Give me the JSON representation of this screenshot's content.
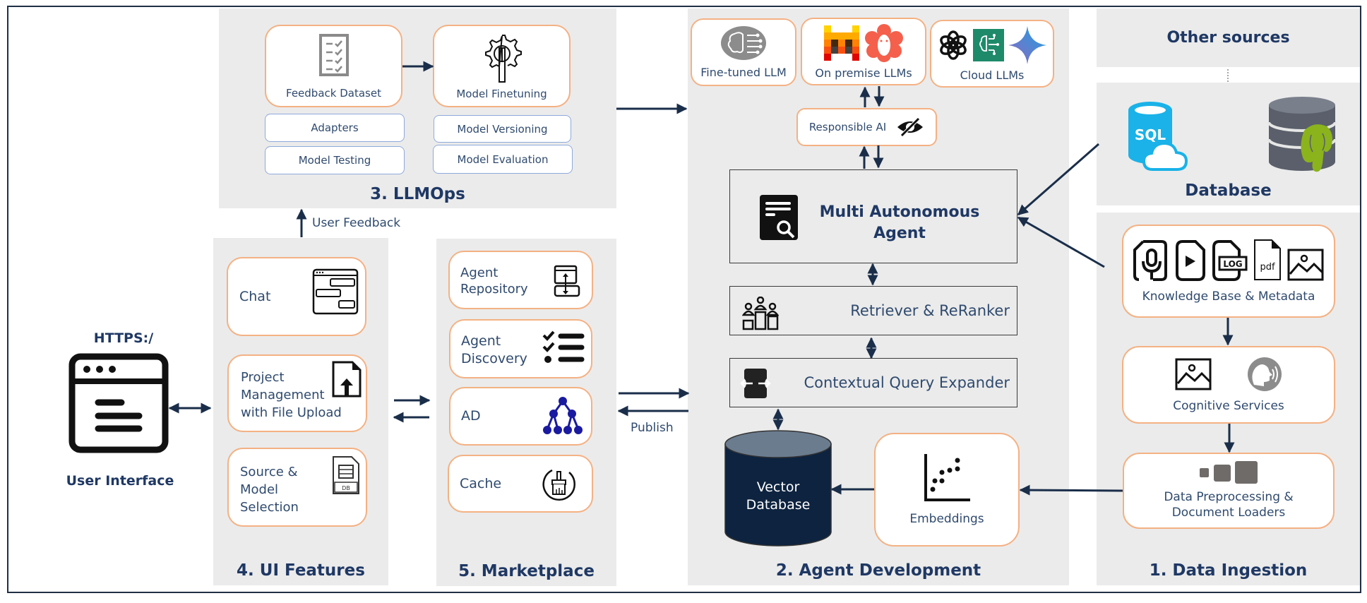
{
  "sections": {
    "llmops": {
      "title": "3. LLMOps",
      "feedback_dataset": "Feedback Dataset",
      "model_finetuning": "Model Finetuning",
      "adapters": "Adapters",
      "model_testing": "Model Testing",
      "model_versioning": "Model Versioning",
      "model_evaluation": "Model Evaluation"
    },
    "ui_features": {
      "title": "4. UI Features",
      "user_feedback": "User Feedback",
      "chat": "Chat",
      "project_management": "Project Management with File Upload",
      "source_model_selection": "Source & Model Selection"
    },
    "marketplace": {
      "title": "5. Marketplace",
      "agent_repository": "Agent Repository",
      "agent_discovery": "Agent Discovery",
      "ad": "AD",
      "cache": "Cache",
      "publish": "Publish"
    },
    "agent_development": {
      "title": "2. Agent Development",
      "fine_tuned_llm": "Fine-tuned LLM",
      "on_premise_llms": "On premise LLMs",
      "cloud_llms": "Cloud LLMs",
      "responsible_ai": "Responsible AI",
      "multi_agent": "Multi Autonomous Agent",
      "retriever": "Retriever & ReRanker",
      "query_expander": "Contextual Query Expander",
      "vector_db_line1": "Vector",
      "vector_db_line2": "Database",
      "embeddings": "Embeddings"
    },
    "data_ingestion": {
      "title": "1. Data Ingestion",
      "other_sources": "Other sources",
      "database": "Database",
      "sql_label": "SQL",
      "knowledge_base": "Knowledge Base & Metadata",
      "log_label": "LOG",
      "pdf_label": "pdf",
      "cognitive_services": "Cognitive Services",
      "preprocessing": "Data Preprocessing & Document Loaders"
    },
    "user_interface": {
      "protocol": "HTTPS:/",
      "title": "User Interface"
    }
  },
  "colors": {
    "navy": "#1f3864",
    "orange_border": "#f4b183",
    "blue_border": "#8eaadb",
    "panel_bg": "#ebebeb",
    "vector_db": "#0d2340"
  }
}
